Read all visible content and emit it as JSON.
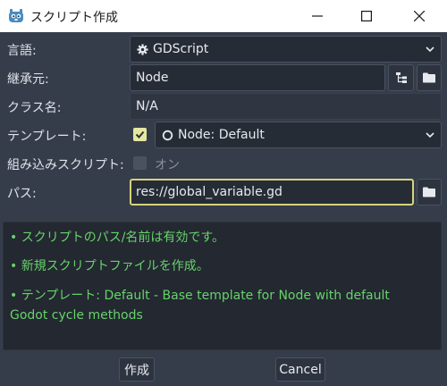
{
  "window": {
    "title": "スクリプト作成",
    "icon": "godot-icon",
    "controls": {
      "minimize": "minimize-icon",
      "maximize": "maximize-icon",
      "close": "close-icon"
    }
  },
  "form": {
    "language": {
      "label": "言語:",
      "value": "GDScript",
      "icon": "gear-icon"
    },
    "inherits": {
      "label": "継承元:",
      "value": "Node"
    },
    "class_name": {
      "label": "クラス名:",
      "value": "N/A"
    },
    "template": {
      "label": "テンプレート:",
      "checked": true,
      "value": "Node: Default"
    },
    "builtin": {
      "label": "組み込みスクリプト:",
      "checked": false,
      "toggle_label": "オン"
    },
    "path": {
      "label": "パス:",
      "value": "res://global_variable.gd"
    }
  },
  "info": {
    "lines": [
      "• スクリプトのパス/名前は有効です。",
      "• 新規スクリプトファイルを作成。",
      "• テンプレート: Default - Base template for Node with default Godot cycle methods"
    ]
  },
  "buttons": {
    "create": "作成",
    "cancel": "Cancel"
  },
  "colors": {
    "background": "#363d4a",
    "field": "#262c36",
    "info_text": "#66d36a",
    "accent": "#d8d27a"
  }
}
